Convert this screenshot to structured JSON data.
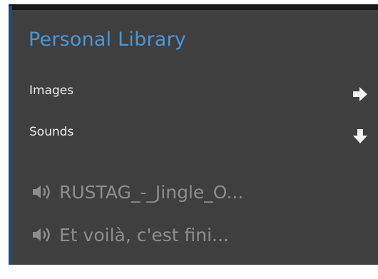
{
  "library": {
    "title": "Personal Library",
    "sections": [
      {
        "label": "Images",
        "expander": "right-arrow-icon",
        "expanded": false
      },
      {
        "label": "Sounds",
        "expander": "down-arrow-icon",
        "expanded": true
      }
    ],
    "sounds": [
      {
        "icon": "speaker-icon",
        "label": "RUSTAG_-_Jingle_O..."
      },
      {
        "icon": "speaker-icon",
        "label": "Et voilà, c'est fini..."
      }
    ]
  },
  "colors": {
    "background": "#3f3f3f",
    "accent": "#4a97d6",
    "border": "#274a72",
    "label": "#f2f2f2",
    "muted": "#8d8d8d"
  }
}
